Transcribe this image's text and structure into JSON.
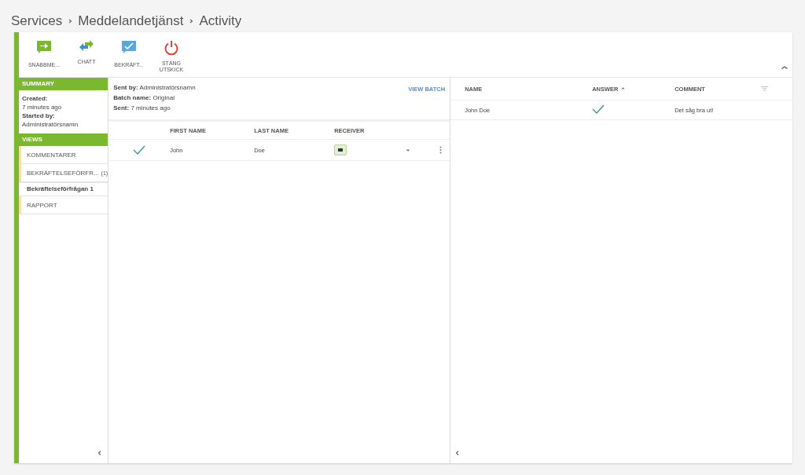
{
  "breadcrumb": [
    "Services",
    "Meddelandetjänst",
    "Activity"
  ],
  "toolbar": [
    {
      "kind": "message",
      "label": "SNABBME..."
    },
    {
      "kind": "chat",
      "label": "CHATT"
    },
    {
      "kind": "confirm",
      "label": "BEKRÄFT..."
    },
    {
      "kind": "power",
      "label": "STÄNG UTSKICK"
    }
  ],
  "summary": {
    "title": "SUMMARY",
    "fields": [
      {
        "label": "Created:",
        "value": "7 minutes ago"
      },
      {
        "label": "Started by:",
        "value": "Administratörsnamn"
      }
    ]
  },
  "views": {
    "title": "VIEWS",
    "items": [
      {
        "label": "KOMMENTARER"
      },
      {
        "label": "BEKRÄFTELSEFÖRFR...",
        "count": "(1)",
        "children": [
          {
            "label": "Bekräftelseförfrågan 1"
          }
        ]
      },
      {
        "label": "RAPPORT"
      }
    ]
  },
  "batch": {
    "fields": [
      {
        "label": "Sent by:",
        "value": "Administratörsnamn"
      },
      {
        "label": "Batch name:",
        "value": "Original"
      },
      {
        "label": "Sent:",
        "value": "7 minutes ago"
      }
    ],
    "link": "VIEW BATCH"
  },
  "recipients": {
    "columns": [
      "FIRST NAME",
      "LAST NAME",
      "RECEIVER"
    ],
    "rows": [
      {
        "checked": true,
        "first_name": "John",
        "last_name": "Doe"
      }
    ]
  },
  "answers": {
    "columns": [
      "NAME",
      "ANSWER",
      "COMMENT"
    ],
    "rows": [
      {
        "name": "John Doe",
        "checked": true,
        "comment": "Det såg bra ut!"
      }
    ]
  }
}
